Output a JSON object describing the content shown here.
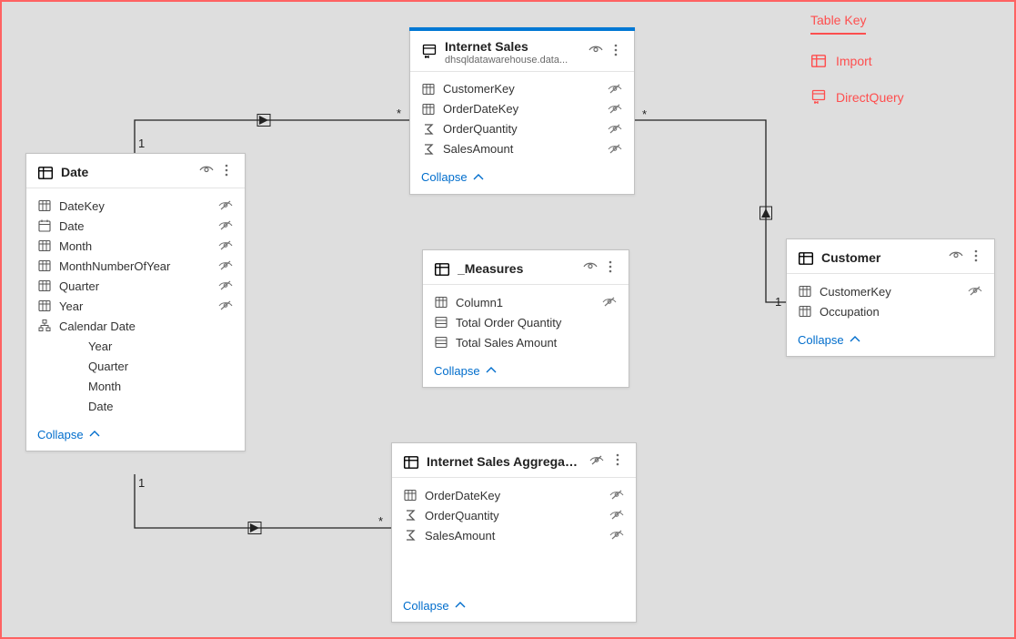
{
  "legend": {
    "title": "Table Key",
    "items": [
      {
        "label": "Import",
        "icon": "table-icon"
      },
      {
        "label": "DirectQuery",
        "icon": "directquery-icon"
      }
    ]
  },
  "collapse_label": "Collapse",
  "tables": {
    "internet_sales": {
      "title": "Internet Sales",
      "subtitle": "dhsqldatawarehouse.data...",
      "icon": "directquery-icon",
      "selected": true,
      "fields": [
        {
          "icon": "column",
          "label": "CustomerKey",
          "hidden": true
        },
        {
          "icon": "column",
          "label": "OrderDateKey",
          "hidden": true
        },
        {
          "icon": "sigma",
          "label": "OrderQuantity",
          "hidden": true
        },
        {
          "icon": "sigma",
          "label": "SalesAmount",
          "hidden": true
        }
      ]
    },
    "date": {
      "title": "Date",
      "icon": "table-icon",
      "fields": [
        {
          "icon": "column",
          "label": "DateKey",
          "hidden": true
        },
        {
          "icon": "date",
          "label": "Date",
          "hidden": true
        },
        {
          "icon": "column",
          "label": "Month",
          "hidden": true
        },
        {
          "icon": "column",
          "label": "MonthNumberOfYear",
          "hidden": true
        },
        {
          "icon": "column",
          "label": "Quarter",
          "hidden": true
        },
        {
          "icon": "column",
          "label": "Year",
          "hidden": true
        },
        {
          "icon": "hierarchy",
          "label": "Calendar Date"
        },
        {
          "icon": "blank",
          "label": "Year",
          "indent": 1
        },
        {
          "icon": "blank",
          "label": "Quarter",
          "indent": 1
        },
        {
          "icon": "blank",
          "label": "Month",
          "indent": 1
        },
        {
          "icon": "blank",
          "label": "Date",
          "indent": 1
        }
      ]
    },
    "measures": {
      "title": "_Measures",
      "icon": "table-icon",
      "fields": [
        {
          "icon": "column",
          "label": "Column1",
          "hidden": true
        },
        {
          "icon": "measure",
          "label": "Total Order Quantity"
        },
        {
          "icon": "measure",
          "label": "Total Sales Amount"
        }
      ]
    },
    "customer": {
      "title": "Customer",
      "icon": "table-icon",
      "fields": [
        {
          "icon": "column",
          "label": "CustomerKey",
          "hidden": true
        },
        {
          "icon": "column",
          "label": "Occupation"
        }
      ]
    },
    "agg": {
      "title": "Internet Sales Aggregation",
      "icon": "table-icon",
      "header_hidden": true,
      "fields": [
        {
          "icon": "column",
          "label": "OrderDateKey",
          "hidden": true
        },
        {
          "icon": "sigma",
          "label": "OrderQuantity",
          "hidden": true
        },
        {
          "icon": "sigma",
          "label": "SalesAmount",
          "hidden": true
        }
      ]
    }
  },
  "relationships": [
    {
      "from": "date",
      "to": "internet_sales",
      "from_card": "1",
      "to_card": "*",
      "direction": "single"
    },
    {
      "from": "date",
      "to": "agg",
      "from_card": "1",
      "to_card": "*",
      "direction": "single"
    },
    {
      "from": "customer",
      "to": "internet_sales",
      "from_card": "1",
      "to_card": "*",
      "direction": "single"
    }
  ]
}
